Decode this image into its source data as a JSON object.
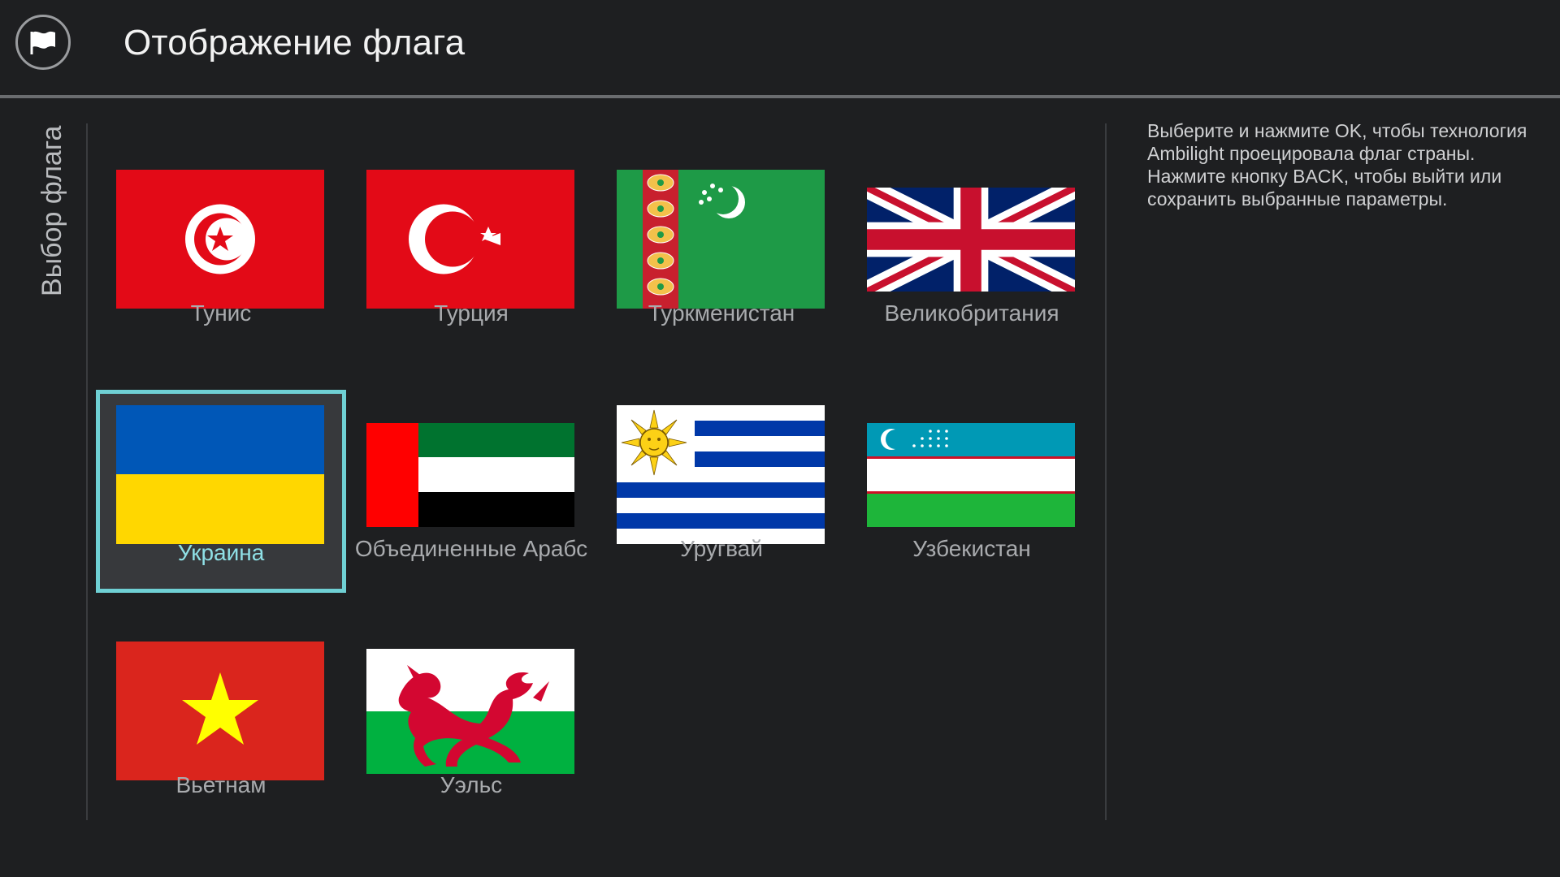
{
  "header": {
    "title": "Отображение флага",
    "icon": "flag-icon"
  },
  "sidebar": {
    "label": "Выбор флага"
  },
  "description": "Выберите и нажмите OK, чтобы технология Ambilight проецировала флаг страны. Нажмите кнопку BACK, чтобы выйти или сохранить выбранные параметры.",
  "flags": [
    {
      "label": "Тунис",
      "selected": false
    },
    {
      "label": "Турция",
      "selected": false
    },
    {
      "label": "Туркменистан",
      "selected": false
    },
    {
      "label": "Великобритания",
      "selected": false
    },
    {
      "label": "Украина",
      "selected": true
    },
    {
      "label": "Объединенные Арабс",
      "selected": false
    },
    {
      "label": "Уругвай",
      "selected": false
    },
    {
      "label": "Узбекистан",
      "selected": false
    },
    {
      "label": "Вьетнам",
      "selected": false
    },
    {
      "label": "Уэльс",
      "selected": false
    }
  ],
  "colors": {
    "background": "#1e1f21",
    "selection": "#6fd0d4",
    "selected_text": "#8fe0e6",
    "text": "#a9abae"
  }
}
